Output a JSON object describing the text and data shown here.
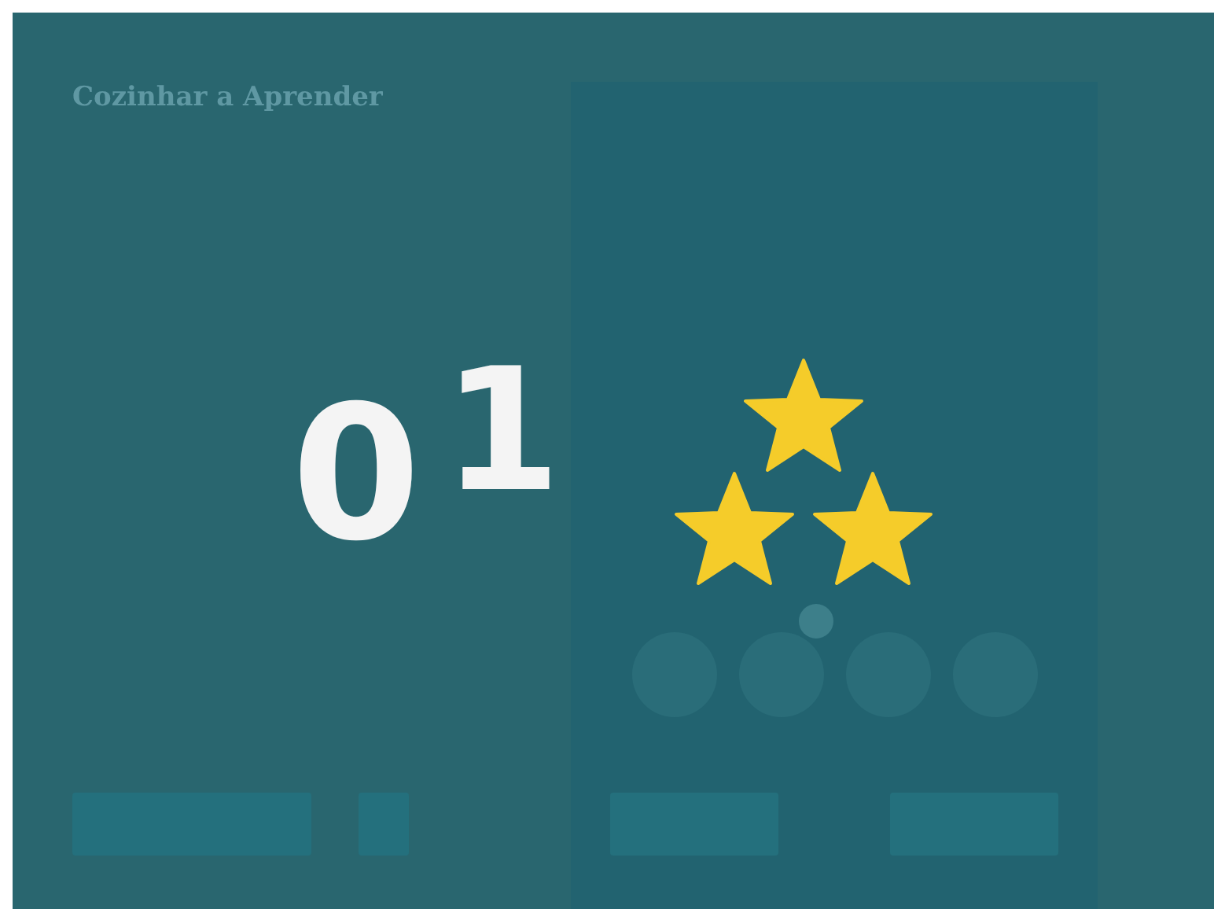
{
  "app": {
    "title": "Cozinhar a Aprender"
  },
  "score": {
    "digits": [
      "0",
      "1"
    ]
  },
  "rating": {
    "badges": [
      {
        "filled": true
      },
      {
        "filled": true
      },
      {
        "filled": true
      }
    ]
  }
}
